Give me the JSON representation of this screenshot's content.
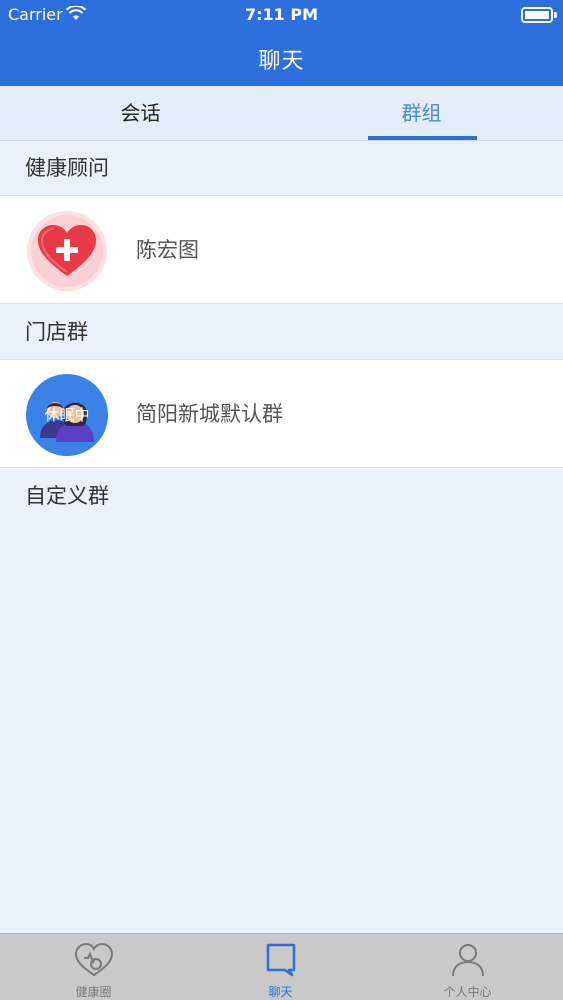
{
  "status_bar": {
    "carrier": "Carrier",
    "time": "7:11 PM"
  },
  "nav": {
    "title": "聊天"
  },
  "tabs": [
    {
      "label": "会话",
      "active": false
    },
    {
      "label": "群组",
      "active": true
    }
  ],
  "sections": [
    {
      "title": "健康顾问",
      "items": [
        {
          "name": "陈宏图",
          "avatar": "heart-plus-icon"
        }
      ]
    },
    {
      "title": "门店群",
      "items": [
        {
          "name": "简阳新城默认群",
          "avatar": "group-avatar",
          "avatar_overlay": "休眠中"
        }
      ]
    },
    {
      "title": "自定义群",
      "items": []
    }
  ],
  "tabbar": [
    {
      "label": "健康圈",
      "icon": "health-heart-icon",
      "active": false
    },
    {
      "label": "聊天",
      "icon": "chat-bubble-icon",
      "active": true
    },
    {
      "label": "个人中心",
      "icon": "person-icon",
      "active": false
    }
  ],
  "colors": {
    "primary": "#2d6fdc",
    "tab_active_text": "#4a86dc",
    "background": "#eaf1fb",
    "tabbar_bg": "#c9c9c9"
  }
}
